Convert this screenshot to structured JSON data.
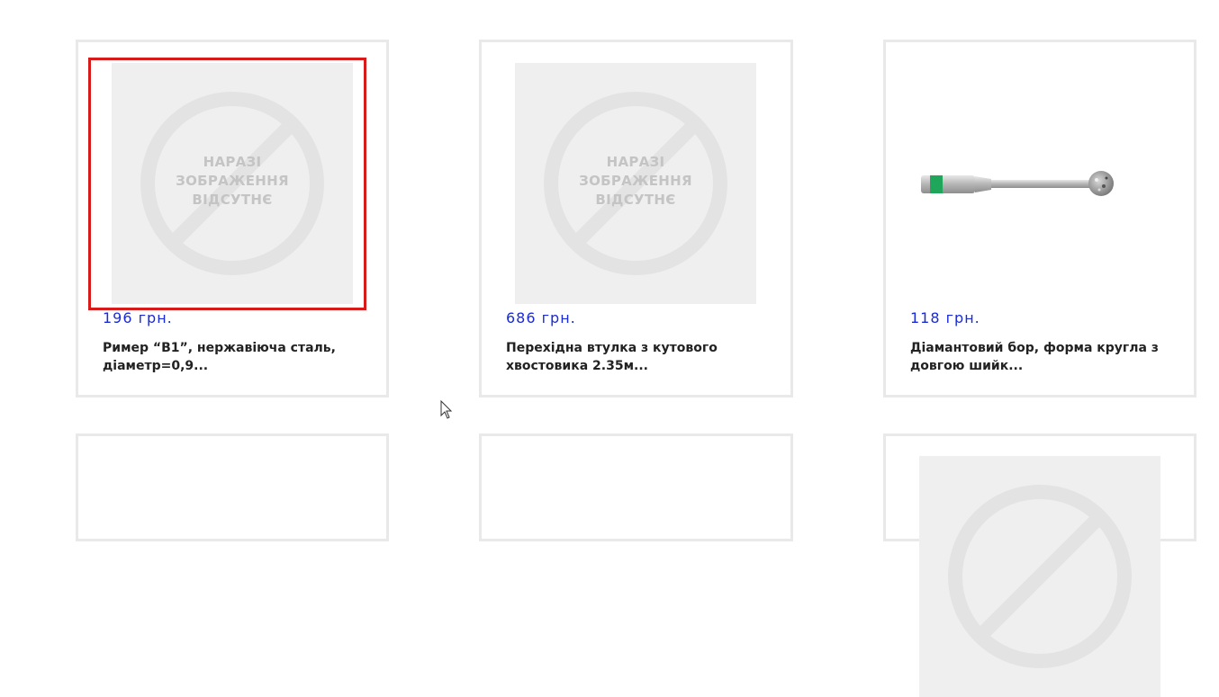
{
  "products": [
    {
      "price": "196 грн.",
      "title_line1": "Ример “B1”, нержавіюча сталь,",
      "title_line2": "діаметр=0,9...",
      "image": "no-image-placeholder"
    },
    {
      "price": "686 грн.",
      "title_line1": "Перехідна втулка з кутового",
      "title_line2": "хвостовика 2.35м...",
      "image": "no-image-placeholder"
    },
    {
      "price": "118 грн.",
      "title_line1": "Діамантовий бор, форма кругла з",
      "title_line2": "довгою шийк...",
      "image": "diamond-bur-photo"
    }
  ],
  "placeholder_text": {
    "line1": "НАРАЗІ",
    "line2": "ЗОБРАЖЕННЯ",
    "line3": "ВІДСУТНЄ"
  },
  "colors": {
    "price": "#1a2bd6",
    "selection": "#d71a1a",
    "border": "#e9e9e9",
    "placeholder_bg": "#efefef",
    "bur_band": "#1fa65a"
  }
}
